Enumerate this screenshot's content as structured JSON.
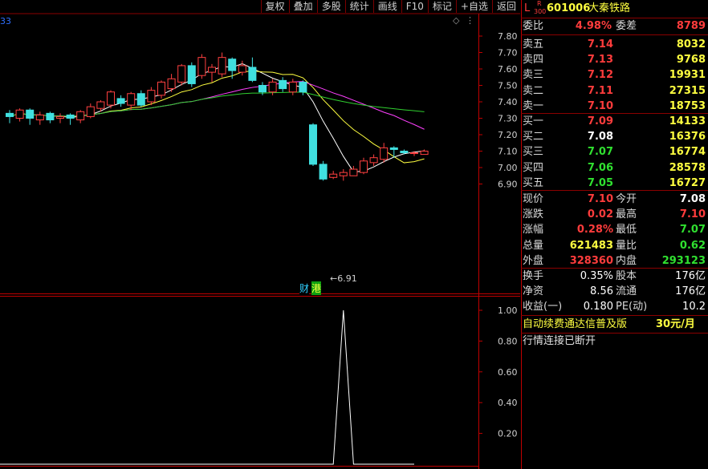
{
  "toolbar": [
    "复权",
    "叠加",
    "多股",
    "统计",
    "画线",
    "F10",
    "标记",
    "+自选",
    "返回"
  ],
  "chart": {
    "top_label": "33",
    "diamond": "◇",
    "dots": "⋮",
    "price_axis": [
      "7.80",
      "7.70",
      "7.60",
      "7.50",
      "7.40",
      "7.30",
      "7.20",
      "7.10",
      "7.00",
      "6.90"
    ],
    "low_marker": "6.91",
    "badges": {
      "cai": "财",
      "gang": "港"
    },
    "indicator_axis": [
      "1.00",
      "0.80",
      "0.60",
      "0.40",
      "0.20"
    ],
    "candles": [
      {
        "o": 7.33,
        "c": 7.31,
        "h": 7.35,
        "l": 7.27
      },
      {
        "o": 7.3,
        "c": 7.35,
        "h": 7.36,
        "l": 7.28
      },
      {
        "o": 7.35,
        "c": 7.3,
        "h": 7.36,
        "l": 7.26
      },
      {
        "o": 7.29,
        "c": 7.32,
        "h": 7.34,
        "l": 7.26
      },
      {
        "o": 7.33,
        "c": 7.29,
        "h": 7.34,
        "l": 7.27
      },
      {
        "o": 7.3,
        "c": 7.31,
        "h": 7.33,
        "l": 7.27
      },
      {
        "o": 7.32,
        "c": 7.3,
        "h": 7.33,
        "l": 7.26
      },
      {
        "o": 7.29,
        "c": 7.34,
        "h": 7.35,
        "l": 7.27
      },
      {
        "o": 7.31,
        "c": 7.37,
        "h": 7.39,
        "l": 7.3
      },
      {
        "o": 7.36,
        "c": 7.4,
        "h": 7.41,
        "l": 7.34
      },
      {
        "o": 7.38,
        "c": 7.46,
        "h": 7.47,
        "l": 7.36
      },
      {
        "o": 7.42,
        "c": 7.39,
        "h": 7.44,
        "l": 7.37
      },
      {
        "o": 7.38,
        "c": 7.45,
        "h": 7.46,
        "l": 7.35
      },
      {
        "o": 7.45,
        "c": 7.38,
        "h": 7.47,
        "l": 7.37
      },
      {
        "o": 7.4,
        "c": 7.47,
        "h": 7.49,
        "l": 7.38
      },
      {
        "o": 7.44,
        "c": 7.52,
        "h": 7.53,
        "l": 7.42
      },
      {
        "o": 7.48,
        "c": 7.54,
        "h": 7.57,
        "l": 7.46
      },
      {
        "o": 7.52,
        "c": 7.62,
        "h": 7.63,
        "l": 7.5
      },
      {
        "o": 7.62,
        "c": 7.51,
        "h": 7.64,
        "l": 7.49
      },
      {
        "o": 7.56,
        "c": 7.67,
        "h": 7.69,
        "l": 7.54
      },
      {
        "o": 7.58,
        "c": 7.61,
        "h": 7.63,
        "l": 7.52
      },
      {
        "o": 7.57,
        "c": 7.67,
        "h": 7.7,
        "l": 7.55
      },
      {
        "o": 7.66,
        "c": 7.59,
        "h": 7.67,
        "l": 7.54
      },
      {
        "o": 7.58,
        "c": 7.62,
        "h": 7.65,
        "l": 7.56
      },
      {
        "o": 7.61,
        "c": 7.53,
        "h": 7.67,
        "l": 7.52
      },
      {
        "o": 7.5,
        "c": 7.46,
        "h": 7.52,
        "l": 7.44
      },
      {
        "o": 7.46,
        "c": 7.52,
        "h": 7.54,
        "l": 7.44
      },
      {
        "o": 7.53,
        "c": 7.48,
        "h": 7.55,
        "l": 7.46
      },
      {
        "o": 7.46,
        "c": 7.52,
        "h": 7.54,
        "l": 7.44
      },
      {
        "o": 7.52,
        "c": 7.46,
        "h": 7.53,
        "l": 7.44
      },
      {
        "o": 7.26,
        "c": 7.02,
        "h": 7.27,
        "l": 7.01
      },
      {
        "o": 7.02,
        "c": 6.93,
        "h": 7.04,
        "l": 6.92
      },
      {
        "o": 6.94,
        "c": 6.96,
        "h": 6.98,
        "l": 6.93
      },
      {
        "o": 6.95,
        "c": 6.97,
        "h": 6.99,
        "l": 6.92
      },
      {
        "o": 6.95,
        "c": 6.99,
        "h": 7.01,
        "l": 6.95
      },
      {
        "o": 6.97,
        "c": 7.04,
        "h": 7.06,
        "l": 6.96
      },
      {
        "o": 7.03,
        "c": 7.06,
        "h": 7.08,
        "l": 7.01
      },
      {
        "o": 7.05,
        "c": 7.12,
        "h": 7.15,
        "l": 7.03
      },
      {
        "o": 7.12,
        "c": 7.11,
        "h": 7.13,
        "l": 7.06
      },
      {
        "o": 7.1,
        "c": 7.09,
        "h": 7.11,
        "l": 7.08
      },
      {
        "o": 7.09,
        "c": 7.09,
        "h": 7.1,
        "l": 7.07
      },
      {
        "o": 7.08,
        "c": 7.1,
        "h": 7.11,
        "l": 7.08
      }
    ],
    "indicator_signal": [
      0,
      0,
      0,
      0,
      0,
      0,
      0,
      0,
      0,
      0,
      0,
      0,
      0,
      0,
      0,
      0,
      0,
      0,
      0,
      0,
      0,
      0,
      0,
      0,
      0,
      0,
      0,
      0,
      0,
      0,
      0,
      0,
      0,
      0,
      1,
      0,
      0,
      0,
      0,
      0,
      0,
      0
    ],
    "colors": {
      "up": "#ff4040",
      "down": "#40e0e0",
      "ma5": "#ffffff",
      "ma10": "#ffff40",
      "ma20": "#ff40ff",
      "ma60": "#30d030",
      "ma120": "#4060ff",
      "ma250": "#d0d0d0",
      "axis": "#c00000"
    }
  },
  "quote": {
    "prefix_l": "L",
    "prefix_r": "R",
    "prefix_300": "300",
    "code": "601006",
    "name": "大秦铁路",
    "weibi_label": "委比",
    "weibi": "4.98%",
    "weicha_label": "委差",
    "weicha": "8789",
    "asks": [
      {
        "label": "卖五",
        "price": "7.14",
        "vol": "8032"
      },
      {
        "label": "卖四",
        "price": "7.13",
        "vol": "9768"
      },
      {
        "label": "卖三",
        "price": "7.12",
        "vol": "19931"
      },
      {
        "label": "卖二",
        "price": "7.11",
        "vol": "27315"
      },
      {
        "label": "卖一",
        "price": "7.10",
        "vol": "18753"
      }
    ],
    "bids": [
      {
        "label": "买一",
        "price": "7.09",
        "vol": "14133",
        "color": "red"
      },
      {
        "label": "买二",
        "price": "7.08",
        "vol": "16376",
        "color": "wht"
      },
      {
        "label": "买三",
        "price": "7.07",
        "vol": "16774",
        "color": "grn"
      },
      {
        "label": "买四",
        "price": "7.06",
        "vol": "28578",
        "color": "grn"
      },
      {
        "label": "买五",
        "price": "7.05",
        "vol": "16727",
        "color": "grn"
      }
    ],
    "stats": [
      {
        "l1": "现价",
        "v1": "7.10",
        "c1": "red",
        "l2": "今开",
        "v2": "7.08",
        "c2": "wht"
      },
      {
        "l1": "涨跌",
        "v1": "0.02",
        "c1": "red",
        "l2": "最高",
        "v2": "7.10",
        "c2": "red"
      },
      {
        "l1": "涨幅",
        "v1": "0.28%",
        "c1": "red",
        "l2": "最低",
        "v2": "7.07",
        "c2": "grn"
      },
      {
        "l1": "总量",
        "v1": "621483",
        "c1": "yel",
        "l2": "量比",
        "v2": "0.62",
        "c2": "grn"
      },
      {
        "l1": "外盘",
        "v1": "328360",
        "c1": "red",
        "l2": "内盘",
        "v2": "293123",
        "c2": "grn"
      }
    ],
    "fin": [
      {
        "l1": "换手",
        "v1": "0.35%",
        "l2": "股本",
        "v2": "176亿"
      },
      {
        "l1": "净资",
        "v1": "8.56",
        "l2": "流通",
        "v2": "176亿"
      },
      {
        "l1": "收益(一)",
        "v1": "0.180",
        "l2": "PE(动)",
        "v2": "10.2"
      }
    ],
    "ad_text": "自动续费通达信普及版",
    "ad_price": "30元/月",
    "status": "行情连接已断开"
  }
}
